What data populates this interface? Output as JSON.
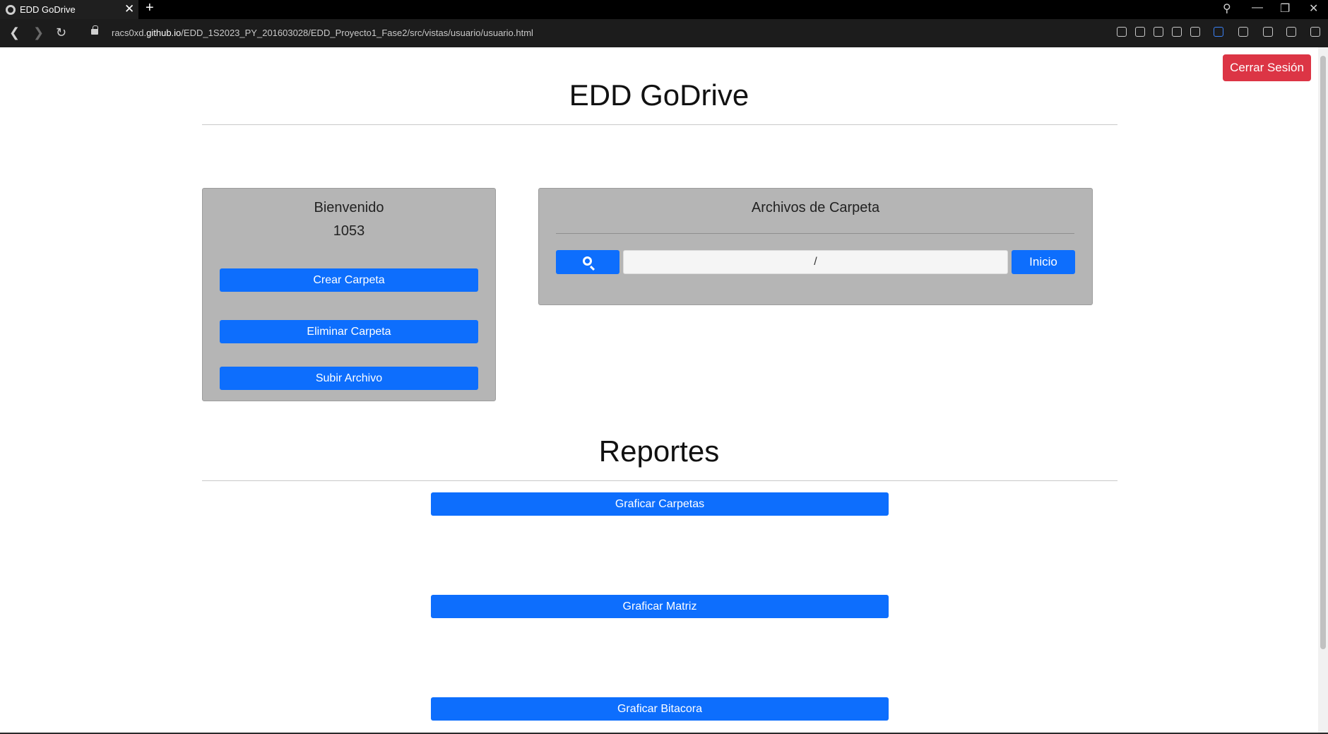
{
  "browser": {
    "tab_title": "EDD GoDrive",
    "tab_close": "✕",
    "new_tab": "+",
    "url_prefix": "racs0xd.",
    "url_domain": "github.io",
    "url_path": "/EDD_1S2023_PY_201603028/EDD_Proyecto1_Fase2/src/vistas/usuario/usuario.html"
  },
  "header": {
    "logout_label": "Cerrar Sesión",
    "title": "EDD GoDrive"
  },
  "welcome": {
    "title": "Bienvenido",
    "user": "1053",
    "buttons": [
      "Crear Carpeta",
      "Eliminar Carpeta",
      "Subir Archivo"
    ]
  },
  "files": {
    "title": "Archivos de Carpeta",
    "path_value": "/",
    "home_label": "Inicio"
  },
  "reports": {
    "title": "Reportes",
    "buttons": [
      "Graficar Carpetas",
      "Graficar Matriz",
      "Graficar Bitacora"
    ]
  },
  "colors": {
    "primary": "#0d6efd",
    "danger": "#dc3545",
    "panel": "#b5b5b5"
  }
}
